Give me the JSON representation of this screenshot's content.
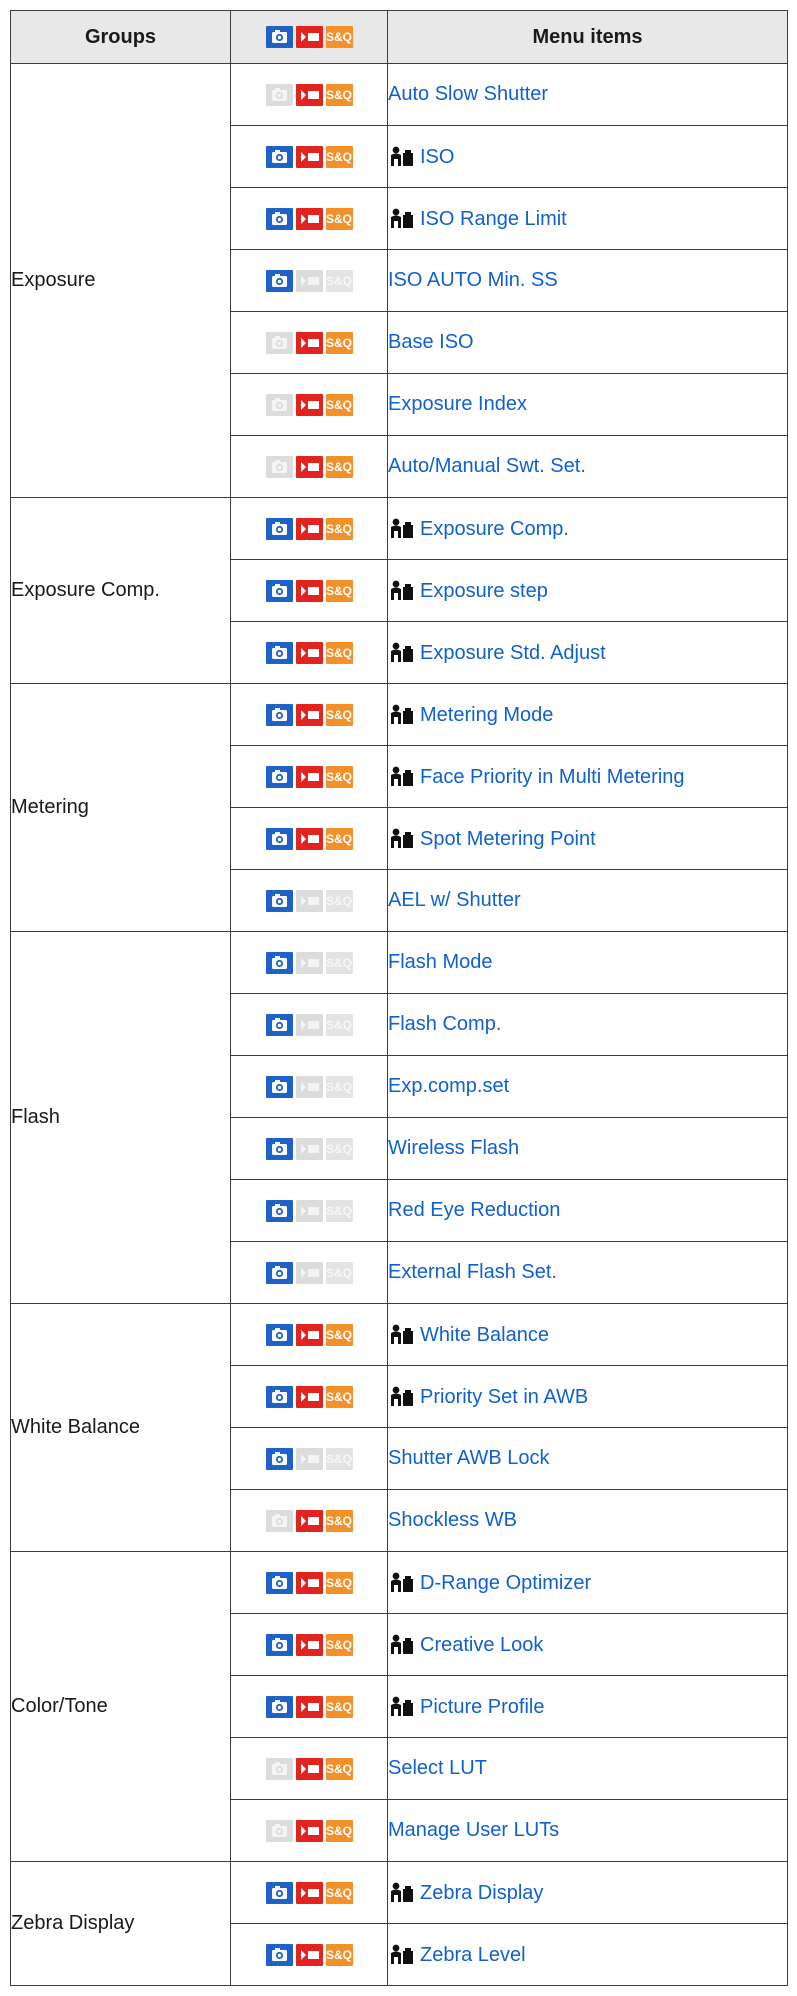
{
  "headers": {
    "groups": "Groups",
    "menu_items": "Menu items"
  },
  "mode_icons": {
    "photo": "photo-mode-icon",
    "movie": "movie-mode-icon",
    "sq": "S&Q"
  },
  "colors": {
    "photo": "#1e62c8",
    "movie": "#e2231f",
    "sq": "#f2912a",
    "disabled": "#dcdcdc",
    "link": "#1060d0"
  },
  "groups": [
    {
      "name": "Exposure",
      "items": [
        {
          "label": "Auto Slow Shutter",
          "p": false,
          "m": true,
          "s": true,
          "pm": false
        },
        {
          "label": "ISO",
          "p": true,
          "m": true,
          "s": true,
          "pm": true
        },
        {
          "label": "ISO Range Limit",
          "p": true,
          "m": true,
          "s": true,
          "pm": true
        },
        {
          "label": "ISO AUTO Min. SS",
          "p": true,
          "m": false,
          "s": false,
          "pm": false
        },
        {
          "label": "Base ISO",
          "p": false,
          "m": true,
          "s": true,
          "pm": false
        },
        {
          "label": "Exposure Index",
          "p": false,
          "m": true,
          "s": true,
          "pm": false
        },
        {
          "label": "Auto/Manual Swt. Set.",
          "p": false,
          "m": true,
          "s": true,
          "pm": false
        }
      ]
    },
    {
      "name": "Exposure Comp.",
      "items": [
        {
          "label": "Exposure Comp.",
          "p": true,
          "m": true,
          "s": true,
          "pm": true
        },
        {
          "label": "Exposure step",
          "p": true,
          "m": true,
          "s": true,
          "pm": true
        },
        {
          "label": "Exposure Std. Adjust",
          "p": true,
          "m": true,
          "s": true,
          "pm": true
        }
      ]
    },
    {
      "name": "Metering",
      "items": [
        {
          "label": "Metering Mode",
          "p": true,
          "m": true,
          "s": true,
          "pm": true
        },
        {
          "label": "Face Priority in Multi Metering",
          "p": true,
          "m": true,
          "s": true,
          "pm": true
        },
        {
          "label": "Spot Metering Point",
          "p": true,
          "m": true,
          "s": true,
          "pm": true
        },
        {
          "label": "AEL w/ Shutter",
          "p": true,
          "m": false,
          "s": false,
          "pm": false
        }
      ]
    },
    {
      "name": "Flash",
      "items": [
        {
          "label": "Flash Mode",
          "p": true,
          "m": false,
          "s": false,
          "pm": false
        },
        {
          "label": "Flash Comp.",
          "p": true,
          "m": false,
          "s": false,
          "pm": false
        },
        {
          "label": "Exp.comp.set",
          "p": true,
          "m": false,
          "s": false,
          "pm": false
        },
        {
          "label": "Wireless Flash",
          "p": true,
          "m": false,
          "s": false,
          "pm": false
        },
        {
          "label": "Red Eye Reduction",
          "p": true,
          "m": false,
          "s": false,
          "pm": false
        },
        {
          "label": "External Flash Set.",
          "p": true,
          "m": false,
          "s": false,
          "pm": false
        }
      ]
    },
    {
      "name": "White Balance",
      "items": [
        {
          "label": "White Balance",
          "p": true,
          "m": true,
          "s": true,
          "pm": true
        },
        {
          "label": "Priority Set in AWB",
          "p": true,
          "m": true,
          "s": true,
          "pm": true
        },
        {
          "label": "Shutter AWB Lock",
          "p": true,
          "m": false,
          "s": false,
          "pm": false
        },
        {
          "label": "Shockless WB",
          "p": false,
          "m": true,
          "s": true,
          "pm": false
        }
      ]
    },
    {
      "name": "Color/Tone",
      "items": [
        {
          "label": "D-Range Optimizer",
          "p": true,
          "m": true,
          "s": true,
          "pm": true
        },
        {
          "label": "Creative Look",
          "p": true,
          "m": true,
          "s": true,
          "pm": true
        },
        {
          "label": "Picture Profile",
          "p": true,
          "m": true,
          "s": true,
          "pm": true
        },
        {
          "label": "Select LUT",
          "p": false,
          "m": true,
          "s": true,
          "pm": false
        },
        {
          "label": "Manage User LUTs",
          "p": false,
          "m": true,
          "s": true,
          "pm": false
        }
      ]
    },
    {
      "name": "Zebra Display",
      "items": [
        {
          "label": "Zebra Display",
          "p": true,
          "m": true,
          "s": true,
          "pm": true
        },
        {
          "label": "Zebra Level",
          "p": true,
          "m": true,
          "s": true,
          "pm": true
        }
      ]
    }
  ]
}
